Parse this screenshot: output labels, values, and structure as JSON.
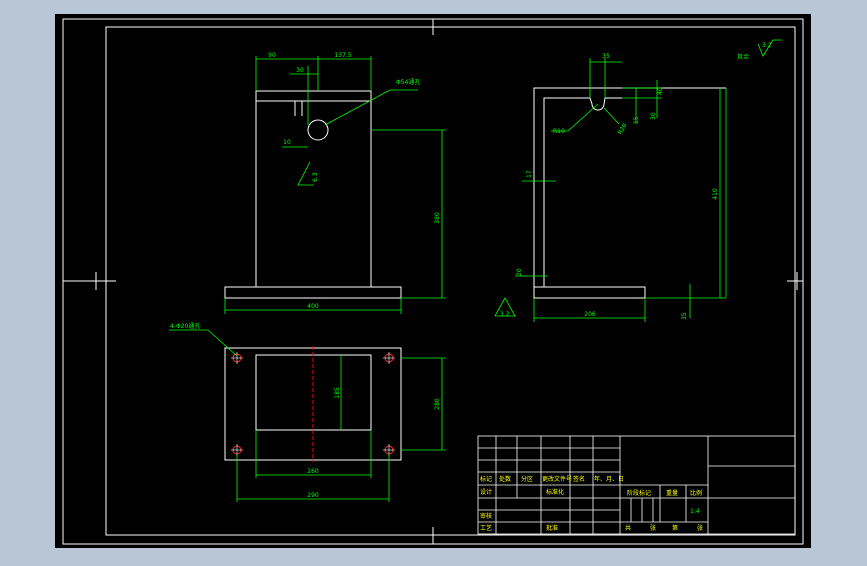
{
  "background_color": "#b9c6d6",
  "paper_color": "#000000",
  "line_color": "#ffffff",
  "dim_color": "#00ff00",
  "center_color": "#ff0000",
  "hole_color": "#ff3030",
  "front_view": {
    "dim_top_left": "90",
    "dim_top_right": "137.5",
    "dim_small_30": "30",
    "hole_note": "Φ54通孔",
    "dim_small_10": "10",
    "roughness_1": "6.3",
    "dim_height": "380",
    "dim_base_width": "400"
  },
  "side_view": {
    "dim_35": "35",
    "dim_40": "40",
    "dim_30": "30",
    "dim_15": "15",
    "dim_r10": "R10",
    "dim_r20": "R20",
    "dim_17": "17",
    "dim_410": "410",
    "dim_20": "20",
    "dim_206": "206",
    "dim_35b": "35",
    "roughness": "3.2"
  },
  "other_roughness": {
    "label": "其余",
    "value": "3.2"
  },
  "top_view": {
    "holes_note": "4-Φ20通孔",
    "dim_185": "185",
    "dim_280": "280",
    "dim_260": "260",
    "dim_290": "290"
  },
  "title_block": {
    "h_mark": "标记",
    "h_count": "处数",
    "h_zone": "分区",
    "h_change_doc": "更改文件号",
    "h_sign": "签名",
    "h_date": "年、月、日",
    "h_design": "设计",
    "h_standard": "标准化",
    "h_stage_mark": "阶段标记",
    "h_weight": "重量",
    "h_scale": "比例",
    "scale_value": "1:4",
    "h_review": "审核",
    "h_process": "工艺",
    "h_approve": "批准",
    "h_total": "共",
    "h_sheet_unit": "张",
    "h_sheet_no": "第"
  }
}
